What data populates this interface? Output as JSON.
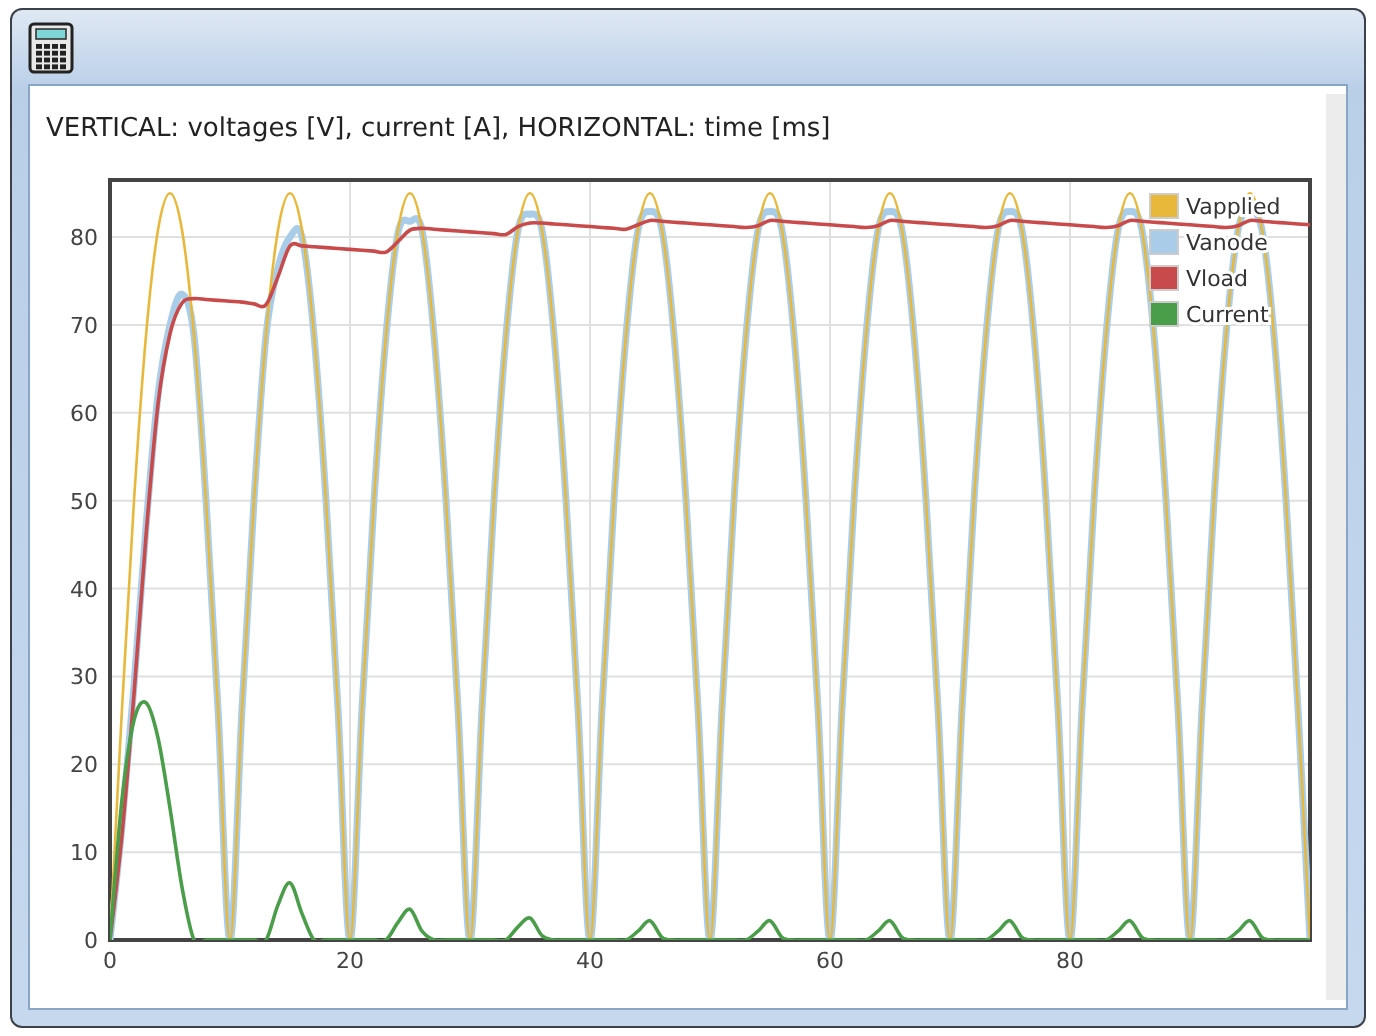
{
  "window": {
    "title": "VERTICAL: voltages [V], current [A], HORIZONTAL: time [ms]"
  },
  "chart_data": {
    "type": "line",
    "xlim": [
      0,
      100
    ],
    "ylim": [
      0,
      86.5
    ],
    "xticks": [
      0,
      20,
      40,
      60,
      80
    ],
    "yticks": [
      0,
      10,
      20,
      30,
      40,
      50,
      60,
      70,
      80
    ],
    "grid": true,
    "legend": true,
    "x": [
      0,
      1,
      2,
      3,
      4,
      5,
      6,
      7,
      8,
      9,
      10,
      11,
      12,
      13,
      14,
      15,
      16,
      17,
      18,
      19,
      20,
      21,
      22,
      23,
      24,
      25,
      26,
      27,
      28,
      29,
      30,
      31,
      32,
      33,
      34,
      35,
      36,
      37,
      38,
      39,
      40,
      41,
      42,
      43,
      44,
      45,
      46,
      47,
      48,
      49,
      50,
      51,
      52,
      53,
      54,
      55,
      56,
      57,
      58,
      59,
      60,
      61,
      62,
      63,
      64,
      65,
      66,
      67,
      68,
      69,
      70,
      71,
      72,
      73,
      74,
      75,
      76,
      77,
      78,
      79,
      80,
      81,
      82,
      83,
      84,
      85,
      86,
      87,
      88,
      89,
      90,
      91,
      92,
      93,
      94,
      95,
      96,
      97,
      98,
      99,
      100
    ],
    "series": [
      {
        "name": "Vapplied",
        "color": "#e8b83a",
        "values": [
          0,
          26.3,
          50,
          68.8,
          80.8,
          85,
          80.8,
          68.8,
          50,
          26.3,
          0,
          26.3,
          50,
          68.8,
          80.8,
          85,
          80.8,
          68.8,
          50,
          26.3,
          0,
          26.3,
          50,
          68.8,
          80.8,
          85,
          80.8,
          68.8,
          50,
          26.3,
          0,
          26.3,
          50,
          68.8,
          80.8,
          85,
          80.8,
          68.8,
          50,
          26.3,
          0,
          26.3,
          50,
          68.8,
          80.8,
          85,
          80.8,
          68.8,
          50,
          26.3,
          0,
          26.3,
          50,
          68.8,
          80.8,
          85,
          80.8,
          68.8,
          50,
          26.3,
          0,
          26.3,
          50,
          68.8,
          80.8,
          85,
          80.8,
          68.8,
          50,
          26.3,
          0,
          26.3,
          50,
          68.8,
          80.8,
          85,
          80.8,
          68.8,
          50,
          26.3,
          0,
          26.3,
          50,
          68.8,
          80.8,
          85,
          80.8,
          68.8,
          50,
          26.3,
          0,
          26.3,
          50,
          68.8,
          80.8,
          85,
          80.8,
          68.8,
          50,
          26.3,
          0
        ]
      },
      {
        "name": "Vanode",
        "color": "#a9cde8",
        "values": [
          0,
          13,
          29,
          47,
          62,
          70,
          73.5,
          68.8,
          50,
          26.3,
          0,
          26.3,
          50,
          68.8,
          76.5,
          80,
          80,
          68.8,
          50,
          26.3,
          0,
          26.3,
          50,
          68.8,
          80.5,
          81.8,
          80.8,
          68.8,
          50,
          26.3,
          0,
          26.3,
          50,
          68.8,
          80.8,
          82.6,
          80.8,
          68.8,
          50,
          26.3,
          0,
          26.3,
          50,
          68.8,
          80.8,
          82.9,
          80.8,
          68.8,
          50,
          26.3,
          0,
          26.3,
          50,
          68.8,
          80.8,
          82.9,
          80.8,
          68.8,
          50,
          26.3,
          0,
          26.3,
          50,
          68.8,
          80.8,
          82.9,
          80.8,
          68.8,
          50,
          26.3,
          0,
          26.3,
          50,
          68.8,
          80.8,
          82.9,
          80.8,
          68.8,
          50,
          26.3,
          0,
          26.3,
          50,
          68.8,
          80.8,
          82.9,
          80.8,
          68.8,
          50,
          26.3,
          0,
          26.3,
          50,
          68.8,
          80.8,
          82.9,
          80.8,
          68.8,
          50,
          26.3,
          0
        ]
      },
      {
        "name": "Vload",
        "color": "#c84a4a",
        "values": [
          0,
          12,
          28,
          46,
          61,
          69,
          72.5,
          73,
          72.9,
          72.8,
          72.7,
          72.6,
          72.4,
          72.3,
          75.5,
          79,
          79,
          78.9,
          78.8,
          78.7,
          78.6,
          78.5,
          78.4,
          78.3,
          79.5,
          80.8,
          81,
          80.9,
          80.8,
          80.7,
          80.6,
          80.5,
          80.4,
          80.3,
          81.2,
          81.6,
          81.6,
          81.5,
          81.4,
          81.3,
          81.2,
          81.1,
          81,
          80.9,
          81.4,
          81.9,
          81.8,
          81.7,
          81.6,
          81.5,
          81.4,
          81.3,
          81.2,
          81.1,
          81.3,
          81.9,
          81.8,
          81.7,
          81.6,
          81.5,
          81.4,
          81.3,
          81.2,
          81.1,
          81.3,
          81.9,
          81.8,
          81.7,
          81.6,
          81.5,
          81.4,
          81.3,
          81.2,
          81.1,
          81.3,
          81.9,
          81.8,
          81.7,
          81.6,
          81.5,
          81.4,
          81.3,
          81.2,
          81.1,
          81.3,
          81.9,
          81.8,
          81.7,
          81.6,
          81.5,
          81.4,
          81.3,
          81.2,
          81.1,
          81.3,
          81.9,
          81.8,
          81.7,
          81.6,
          81.5,
          81.4
        ]
      },
      {
        "name": "Current",
        "color": "#4a9e4a",
        "values": [
          0,
          16,
          25,
          27,
          23,
          15,
          6,
          0,
          0,
          0,
          0,
          0,
          0,
          0,
          4,
          6.5,
          3,
          0,
          0,
          0,
          0,
          0,
          0,
          0,
          2,
          3.5,
          1,
          0,
          0,
          0,
          0,
          0,
          0,
          0,
          1.5,
          2.5,
          0.5,
          0,
          0,
          0,
          0,
          0,
          0,
          0,
          1,
          2.2,
          0.3,
          0,
          0,
          0,
          0,
          0,
          0,
          0,
          1,
          2.2,
          0.3,
          0,
          0,
          0,
          0,
          0,
          0,
          0,
          1,
          2.2,
          0.3,
          0,
          0,
          0,
          0,
          0,
          0,
          0,
          1,
          2.2,
          0.3,
          0,
          0,
          0,
          0,
          0,
          0,
          0,
          1,
          2.2,
          0.3,
          0,
          0,
          0,
          0,
          0,
          0,
          0,
          1,
          2.2,
          0.3,
          0,
          0,
          0,
          0
        ]
      }
    ]
  }
}
